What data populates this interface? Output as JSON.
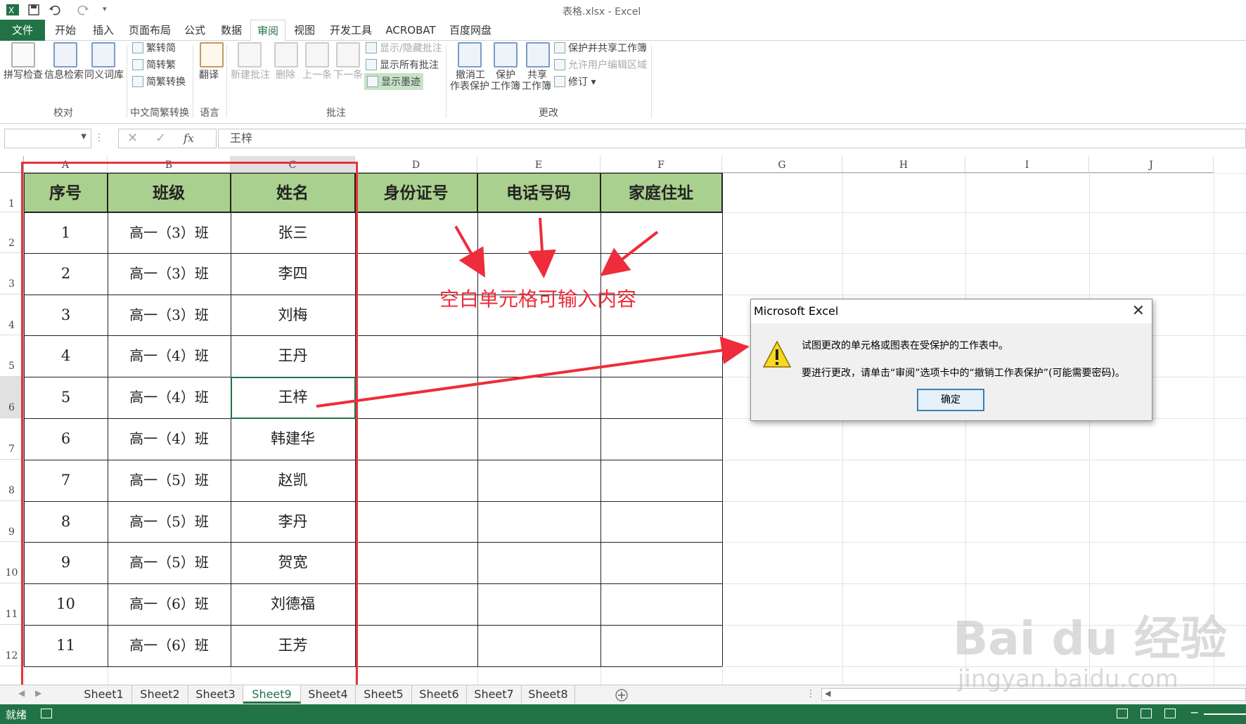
{
  "title_bar": {
    "doc_title": "表格.xlsx - Excel"
  },
  "tabs": [
    "文件",
    "开始",
    "插入",
    "页面布局",
    "公式",
    "数据",
    "审阅",
    "视图",
    "开发工具",
    "ACROBAT",
    "百度网盘"
  ],
  "ribbon": {
    "proofing": {
      "spell": "拼写检查",
      "research": "信息检索",
      "thesaurus": "同义词库",
      "label": "校对"
    },
    "chinese": {
      "t2s": "繁转简",
      "s2t": "简转繁",
      "convert": "简繁转换",
      "label": "中文简繁转换"
    },
    "language": {
      "translate": "翻译",
      "label": "语言"
    },
    "comments": {
      "new": "新建批注",
      "delete": "删除",
      "prev": "上一条",
      "next": "下一条",
      "show_hide": "显示/隐藏批注",
      "show_all": "显示所有批注",
      "show_ink": "显示墨迹",
      "label": "批注"
    },
    "changes": {
      "unprotect_l1": "撤消工",
      "unprotect_l2": "作表保护",
      "protect_l1": "保护",
      "protect_l2": "工作簿",
      "share_l1": "共享",
      "share_l2": "工作簿",
      "protect_share": "保护并共享工作簿",
      "allow_edit": "允许用户编辑区域",
      "track": "修订",
      "label": "更改"
    }
  },
  "formula_bar": {
    "fx": "fx",
    "value": "王梓"
  },
  "columns": [
    "A",
    "B",
    "C",
    "D",
    "E",
    "F",
    "G",
    "H",
    "I",
    "J"
  ],
  "rows": [
    "1",
    "2",
    "3",
    "4",
    "5",
    "6",
    "7",
    "8",
    "9",
    "10",
    "11",
    "12"
  ],
  "table": {
    "headers": [
      "序号",
      "班级",
      "姓名",
      "身份证号",
      "电话号码",
      "家庭住址"
    ],
    "rows": [
      [
        "1",
        "高一（3）班",
        "张三"
      ],
      [
        "2",
        "高一（3）班",
        "李四"
      ],
      [
        "3",
        "高一（3）班",
        "刘梅"
      ],
      [
        "4",
        "高一（4）班",
        "王丹"
      ],
      [
        "5",
        "高一（4）班",
        "王梓"
      ],
      [
        "6",
        "高一（4）班",
        "韩建华"
      ],
      [
        "7",
        "高一（5）班",
        "赵凯"
      ],
      [
        "8",
        "高一（5）班",
        "李丹"
      ],
      [
        "9",
        "高一（5）班",
        "贺宽"
      ],
      [
        "10",
        "高一（6）班",
        "刘德福"
      ],
      [
        "11",
        "高一（6）班",
        "王芳"
      ]
    ]
  },
  "annotation": "空白单元格可输入内容",
  "dialog": {
    "title": "Microsoft Excel",
    "line1": "试图更改的单元格或图表在受保护的工作表中。",
    "line2": "要进行更改，请单击“审阅”选项卡中的“撤销工作表保护”(可能需要密码)。",
    "ok": "确定"
  },
  "sheets": [
    "Sheet1",
    "Sheet2",
    "Sheet3",
    "Sheet9",
    "Sheet4",
    "Sheet5",
    "Sheet6",
    "Sheet7",
    "Sheet8"
  ],
  "active_sheet": "Sheet9",
  "status": "就绪",
  "watermark": {
    "brand": "Bai du 经验",
    "url": "jingyan.baidu.com"
  },
  "colors": {
    "excel_green": "#217346",
    "header_fill": "#a9d08e",
    "annotation_red": "#ee2c3b"
  }
}
